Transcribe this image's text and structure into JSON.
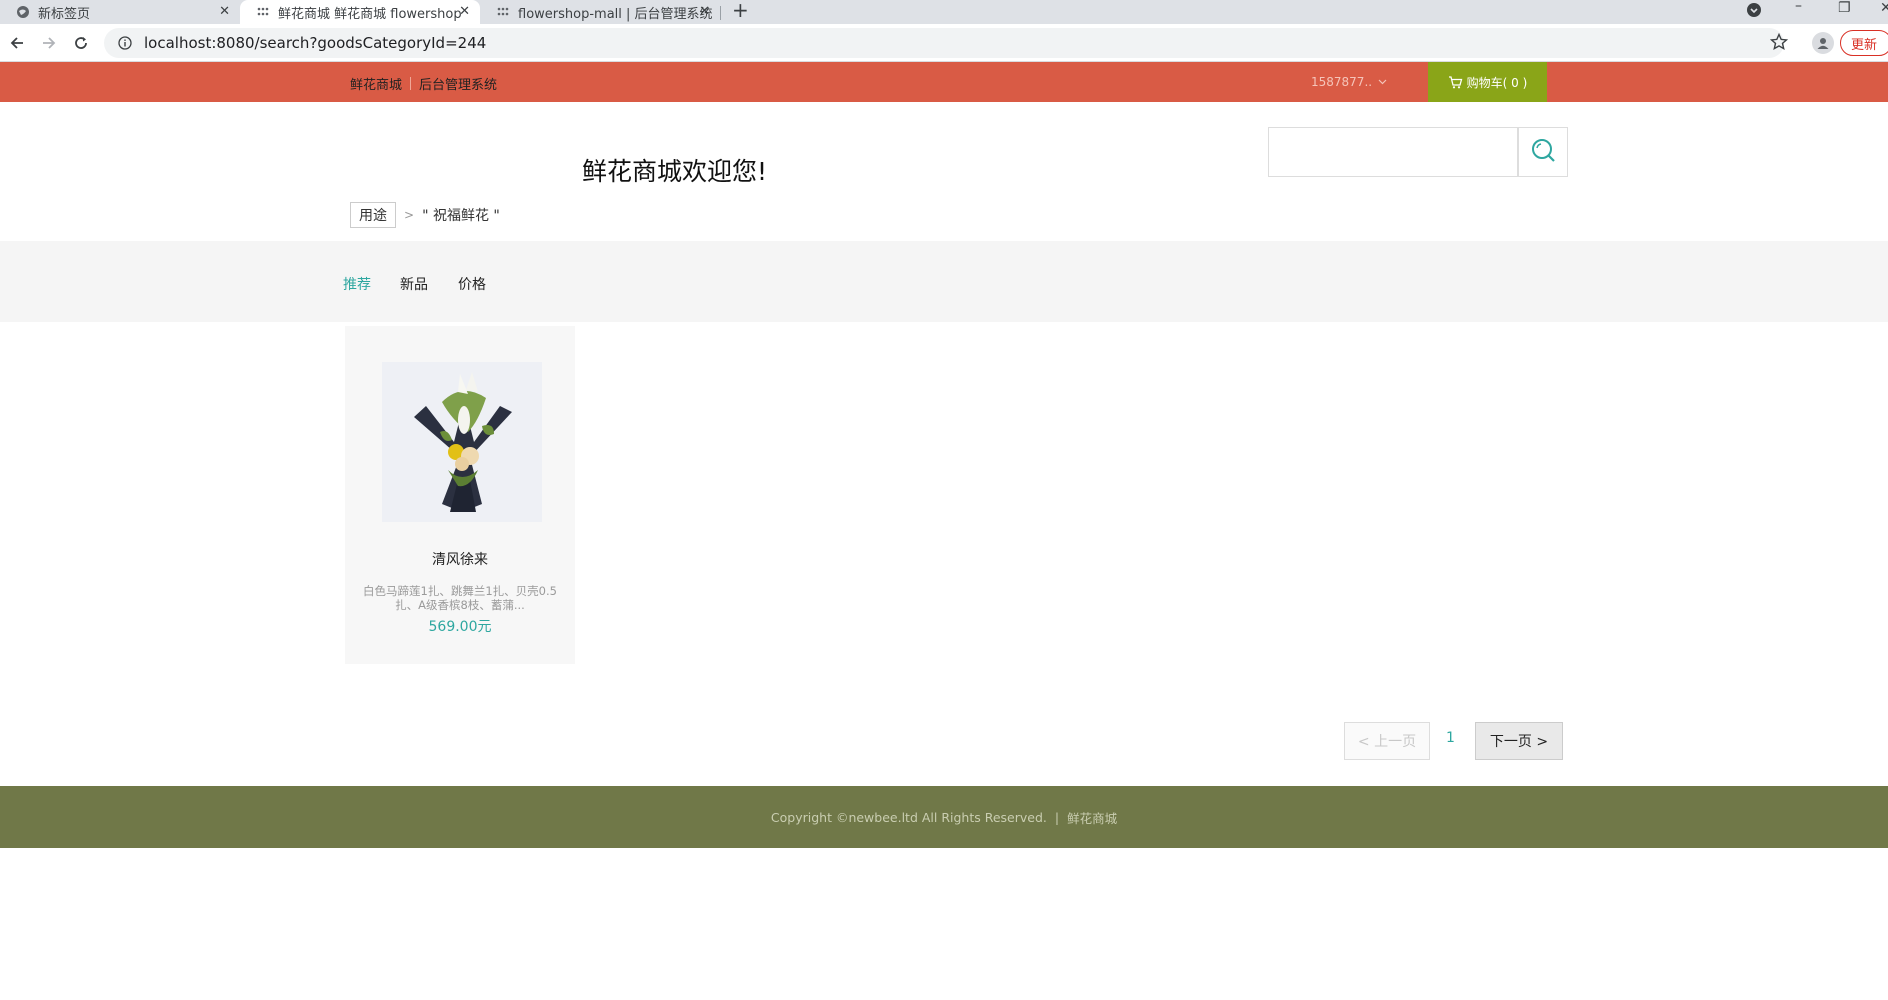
{
  "browser": {
    "tabs": [
      {
        "title": "新标签页"
      },
      {
        "title": "鲜花商城 鲜花商城 flowershop"
      },
      {
        "title": "flowershop-mall | 后台管理系统"
      }
    ],
    "url": "localhost:8080/search?goodsCategoryId=244",
    "update_label": "更新"
  },
  "topbar": {
    "home_link": "鲜花商城",
    "admin_link": "后台管理系统",
    "user": "1587877..",
    "cart_label": "购物车( 0 )"
  },
  "header": {
    "welcome": "鲜花商城欢迎您!",
    "search_value": ""
  },
  "breadcrumb": {
    "category": "用途",
    "current": "\" 祝福鲜花 \""
  },
  "sort": {
    "recommend": "推荐",
    "new": "新品",
    "price": "价格"
  },
  "products": [
    {
      "name": "清风徐来",
      "desc": "白色马蹄莲1扎、跳舞兰1扎、贝壳0.5扎、A级香槟8枝、蓄蒲...",
      "price": "569.00元"
    }
  ],
  "pagination": {
    "prev": "< 上一页",
    "current": "1",
    "next": "下一页 >"
  },
  "footer": {
    "copyright": "Copyright ©newbee.ltd All Rights Reserved.",
    "sep": "|",
    "brand": "鲜花商城"
  },
  "colors": {
    "topbar": "#d95b45",
    "cart": "#8aa518",
    "accent": "#2ea7a0",
    "footer": "#707848"
  }
}
